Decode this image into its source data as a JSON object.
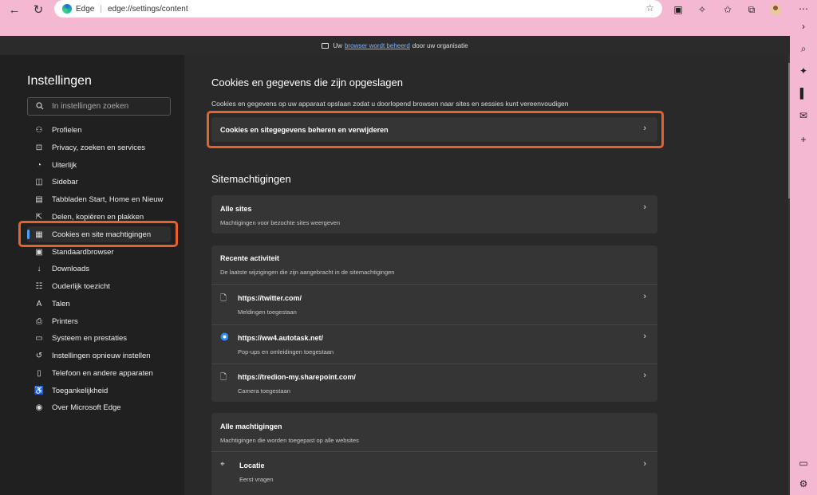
{
  "browser": {
    "brand": "Edge",
    "url": "edge://settings/content"
  },
  "banner": {
    "prefix": "Uw",
    "link": "browser wordt beheerd",
    "suffix": "door uw organisatie"
  },
  "sidebar": {
    "title": "Instellingen",
    "search_placeholder": "In instellingen zoeken",
    "items": [
      {
        "label": "Profielen",
        "icon": "person-icon"
      },
      {
        "label": "Privacy, zoeken en services",
        "icon": "lock-icon"
      },
      {
        "label": "Uiterlijk",
        "icon": "palette-icon"
      },
      {
        "label": "Sidebar",
        "icon": "sidebar-icon"
      },
      {
        "label": "Tabbladen Start, Home en Nieuw",
        "icon": "home-icon"
      },
      {
        "label": "Delen, kopiëren en plakken",
        "icon": "share-icon"
      },
      {
        "label": "Cookies en site machtigingen",
        "icon": "cookie-icon"
      },
      {
        "label": "Standaardbrowser",
        "icon": "browser-icon"
      },
      {
        "label": "Downloads",
        "icon": "download-icon"
      },
      {
        "label": "Ouderlijk toezicht",
        "icon": "family-icon"
      },
      {
        "label": "Talen",
        "icon": "language-icon"
      },
      {
        "label": "Printers",
        "icon": "printer-icon"
      },
      {
        "label": "Systeem en prestaties",
        "icon": "laptop-icon"
      },
      {
        "label": "Instellingen opnieuw instellen",
        "icon": "reset-icon"
      },
      {
        "label": "Telefoon en andere apparaten",
        "icon": "phone-icon"
      },
      {
        "label": "Toegankelijkheid",
        "icon": "accessibility-icon"
      },
      {
        "label": "Over Microsoft Edge",
        "icon": "edge-icon"
      }
    ]
  },
  "main": {
    "cookies_heading": "Cookies en gegevens die zijn opgeslagen",
    "cookies_desc": "Cookies en gegevens op uw apparaat opslaan zodat u doorlopend browsen naar sites en sessies kunt vereenvoudigen",
    "cookies_manage": "Cookies en sitegegevens beheren en verwijderen",
    "permissions_heading": "Sitemachtigingen",
    "all_sites": {
      "title": "Alle sites",
      "desc": "Machtigingen voor bezochte sites weergeven"
    },
    "recent": {
      "title": "Recente activiteit",
      "desc": "De laatste wijzigingen die zijn aangebracht in de sitemachtigingen",
      "sites": [
        {
          "url": "https://twitter.com/",
          "detail": "Meldingen toegestaan",
          "icon": "page-icon"
        },
        {
          "url": "https://ww4.autotask.net/",
          "detail": "Pop-ups en omleidingen toegestaan",
          "icon": "autotask-icon"
        },
        {
          "url": "https://tredion-my.sharepoint.com/",
          "detail": "Camera toegestaan",
          "icon": "page-icon"
        }
      ]
    },
    "all_permissions": {
      "title": "Alle machtigingen",
      "desc": "Machtigingen die worden toegepast op alle websites",
      "location": {
        "title": "Locatie",
        "desc": "Eerst vragen"
      }
    }
  },
  "colors": {
    "highlight": "#e8602a",
    "accent": "#4aa0ff"
  }
}
